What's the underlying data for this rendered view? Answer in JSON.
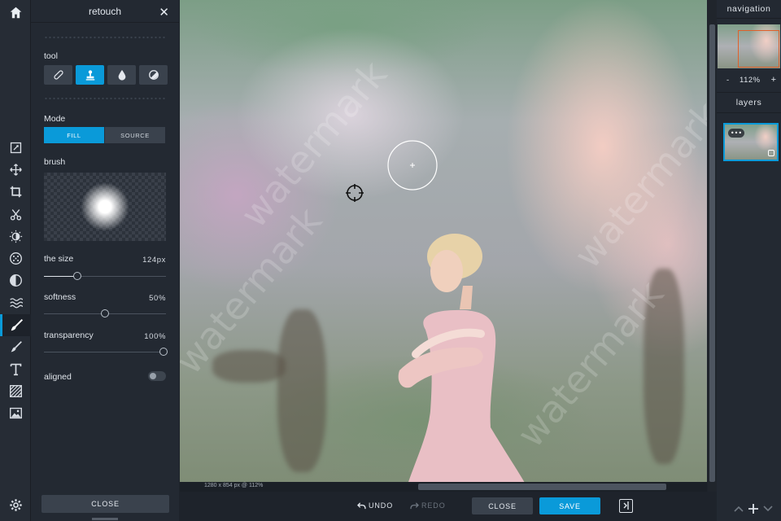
{
  "panel": {
    "title": "retouch",
    "close_glyph": "✕",
    "tool_label": "tool",
    "tools": [
      {
        "icon": "bandage-icon",
        "active": false
      },
      {
        "icon": "clone-stamp-icon",
        "active": true
      },
      {
        "icon": "drop-icon",
        "active": false
      },
      {
        "icon": "contrast-circle-icon",
        "active": false
      }
    ],
    "mode_label": "Mode",
    "mode_options": [
      "FILL",
      "SOURCE"
    ],
    "mode_selected": "FILL",
    "brush_label": "brush",
    "size_label": "the size",
    "size_value": "124px",
    "size_level": 0.27,
    "softness_label": "softness",
    "softness_value": "50%",
    "softness_level": 0.5,
    "transparency_label": "transparency",
    "transparency_value": "100%",
    "transparency_level": 1.0,
    "aligned_label": "aligned",
    "aligned_on": false,
    "close_button": "CLOSE"
  },
  "rail": {
    "icons": [
      "edit-icon",
      "move-icon",
      "crop-icon",
      "cut-icon",
      "adjust-icon",
      "filter-icon",
      "vignette-icon",
      "wave-icon",
      "retouch-brush-icon",
      "paint-brush-icon",
      "text-icon",
      "texture-icon",
      "image-icon"
    ],
    "active": "retouch-brush-icon",
    "home_icon": "home-icon",
    "settings_icon": "gear-icon"
  },
  "canvas": {
    "info": "1280 x 854 px @ 112%",
    "watermark_text": "watermark"
  },
  "actionbar": {
    "undo": "UNDO",
    "redo": "REDO",
    "close": "CLOSE",
    "save": "SAVE"
  },
  "right": {
    "navigation_title": "navigation",
    "zoom_minus": "-",
    "zoom_value": "112%",
    "zoom_plus": "+",
    "layers_title": "layers",
    "layer_more": "•••"
  },
  "colors": {
    "accent": "#0a9ad9",
    "panel_bg": "#232932",
    "nav_viewport": "#e0602a"
  }
}
